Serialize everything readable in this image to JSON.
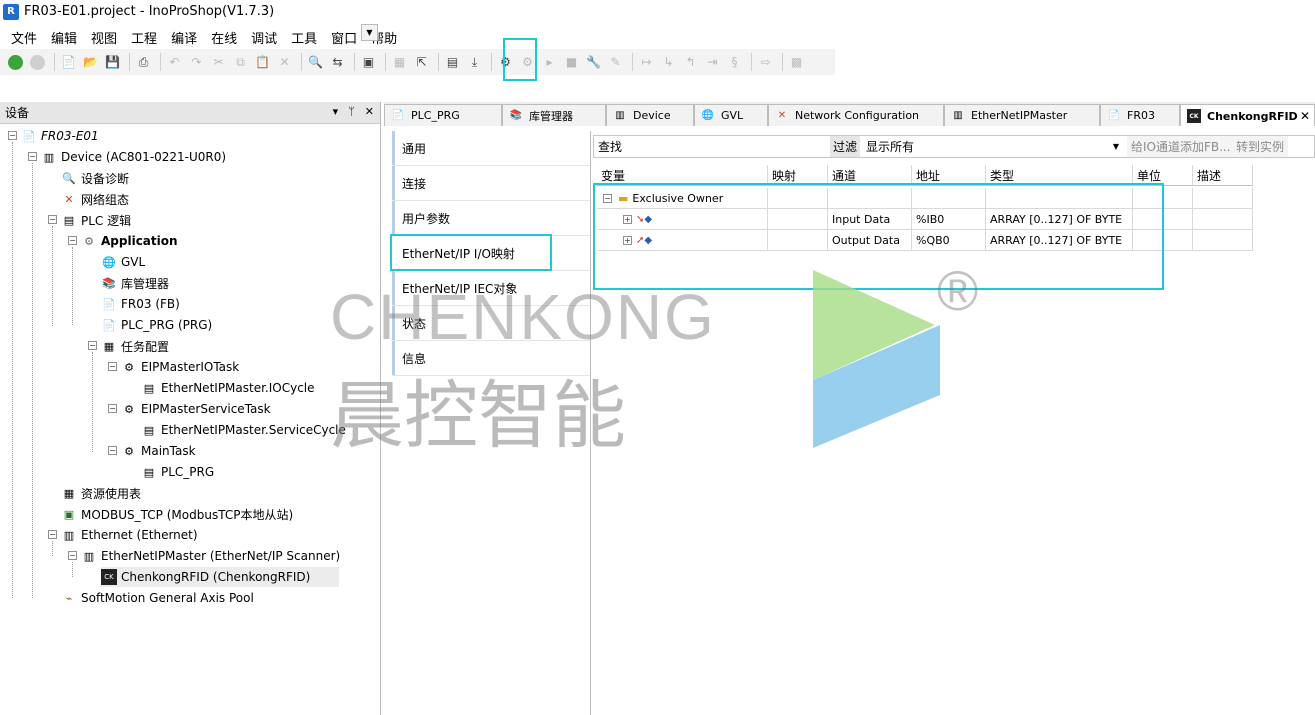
{
  "window": {
    "title": "FR03-E01.project - InoProShop(V1.7.3)",
    "app_icon_glyph": "R"
  },
  "menu": [
    "文件",
    "编辑",
    "视图",
    "工程",
    "编译",
    "在线",
    "调试",
    "工具",
    "窗口",
    "帮助"
  ],
  "devices_panel": {
    "title": "设备",
    "header_buttons": [
      "▾",
      "ᛘ",
      "✕"
    ],
    "tree": [
      {
        "label": "FR03-E01"
      },
      {
        "label": "Device (AC801-0221-U0R0)"
      },
      {
        "label": "设备诊断"
      },
      {
        "label": "网络组态"
      },
      {
        "label": "PLC 逻辑"
      },
      {
        "label": "Application"
      },
      {
        "label": "GVL"
      },
      {
        "label": "库管理器"
      },
      {
        "label": "FR03 (FB)"
      },
      {
        "label": "PLC_PRG (PRG)"
      },
      {
        "label": "任务配置"
      },
      {
        "label": "EIPMasterIOTask"
      },
      {
        "label": "EtherNetIPMaster.IOCycle"
      },
      {
        "label": "EIPMasterServiceTask"
      },
      {
        "label": "EtherNetIPMaster.ServiceCycle"
      },
      {
        "label": "MainTask"
      },
      {
        "label": "PLC_PRG"
      },
      {
        "label": "资源使用表"
      },
      {
        "label": "MODBUS_TCP (ModbusTCP本地从站)"
      },
      {
        "label": "Ethernet (Ethernet)"
      },
      {
        "label": "EtherNetIPMaster (EtherNet/IP Scanner)"
      },
      {
        "label": "ChenkongRFID (ChenkongRFID)"
      },
      {
        "label": "SoftMotion General Axis Pool"
      }
    ]
  },
  "editor_tabs": [
    {
      "label": "PLC_PRG"
    },
    {
      "label": "库管理器"
    },
    {
      "label": "Device"
    },
    {
      "label": "GVL"
    },
    {
      "label": "Network Configuration"
    },
    {
      "label": "EtherNetIPMaster"
    },
    {
      "label": "FR03"
    },
    {
      "label": "ChenkongRFID",
      "active": true
    }
  ],
  "side_tabs": [
    "通用",
    "连接",
    "用户参数",
    "EtherNet/IP I/O映射",
    "EtherNet/IP IEC对象",
    "状态",
    "信息"
  ],
  "filter_bar": {
    "find_label": "查找",
    "filter_label": "过滤",
    "filter_value": "显示所有",
    "add_io_label": "给IO通道添加FB...",
    "goto_label": "转到实例"
  },
  "mapping_table": {
    "columns": [
      "变量",
      "映射",
      "通道",
      "地址",
      "类型",
      "单位",
      "描述"
    ],
    "group": "Exclusive Owner",
    "rows": [
      {
        "channel": "Input Data",
        "address": "%IB0",
        "type": "ARRAY [0..127] OF BYTE"
      },
      {
        "channel": "Output Data",
        "address": "%QB0",
        "type": "ARRAY [0..127] OF BYTE"
      }
    ]
  },
  "watermark": {
    "text": "CHENKONG",
    "chinese": "晨控智能",
    "registered": "®"
  },
  "colors": {
    "highlight": "#1fc6d4",
    "app_icon": "#1f6fc9",
    "watermark_green": "#a6dc84",
    "watermark_blue": "#7fc3ea"
  }
}
